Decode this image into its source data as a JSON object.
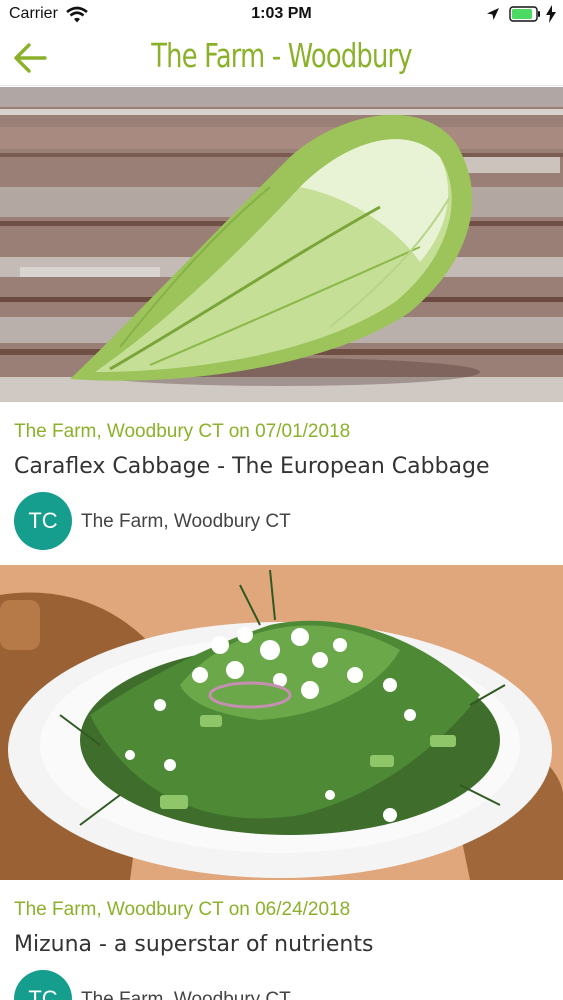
{
  "status_bar": {
    "carrier": "Carrier",
    "time": "1:03 PM",
    "icons": [
      "wifi-icon",
      "location-arrow-icon",
      "battery-icon",
      "charging-bolt-icon"
    ]
  },
  "nav": {
    "back_icon": "arrow-left-icon",
    "title": "The Farm - Woodbury"
  },
  "colors": {
    "accent_green": "#8bb12b",
    "avatar_teal": "#159d8e",
    "title_text": "#333333"
  },
  "posts": [
    {
      "image": "cabbage-photo",
      "meta": "The Farm, Woodbury CT on 07/01/2018",
      "title": "Caraflex Cabbage - The European Cabbage",
      "avatar_initials": "TC",
      "author": "The Farm, Woodbury CT"
    },
    {
      "image": "mizuna-salad-photo",
      "meta": "The Farm, Woodbury CT on 06/24/2018",
      "title": "Mizuna - a superstar of nutrients",
      "avatar_initials": "TC",
      "author": "The Farm, Woodbury CT"
    }
  ]
}
